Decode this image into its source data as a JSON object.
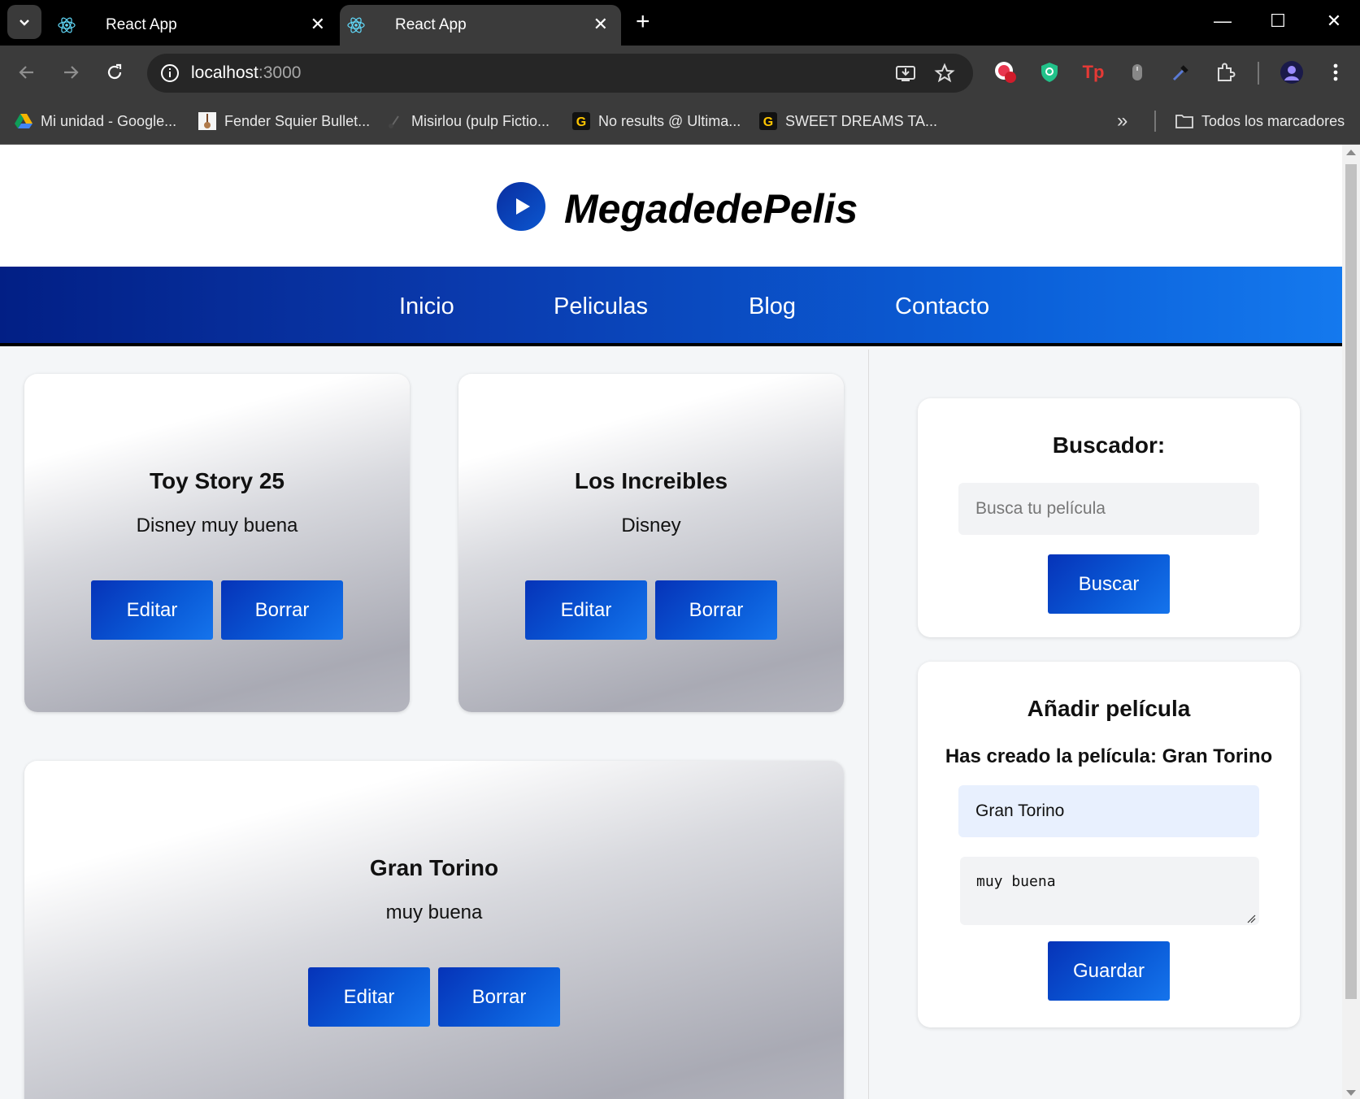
{
  "browser": {
    "tabs": [
      {
        "title": "React App",
        "active": false
      },
      {
        "title": "React App",
        "active": true
      }
    ],
    "address": {
      "host": "localhost",
      "port": ":3000"
    },
    "bookmarks": [
      {
        "label": "Mi unidad - Google...",
        "icon": "google-drive-icon"
      },
      {
        "label": "Fender Squier Bullet...",
        "icon": "guitar-icon"
      },
      {
        "label": "Misirlou (pulp Fictio...",
        "icon": "music-icon"
      },
      {
        "label": "No results @ Ultima...",
        "icon": "ultimate-guitar-icon"
      },
      {
        "label": "SWEET DREAMS TA...",
        "icon": "ultimate-guitar-icon"
      }
    ],
    "all_bookmarks_label": "Todos los marcadores",
    "badge_count": "!"
  },
  "site": {
    "title": "MegadedePelis",
    "nav": [
      "Inicio",
      "Peliculas",
      "Blog",
      "Contacto"
    ]
  },
  "movies": [
    {
      "title": "Toy Story 25",
      "description": "Disney muy buena",
      "edit_label": "Editar",
      "delete_label": "Borrar"
    },
    {
      "title": "Los Increibles",
      "description": "Disney",
      "edit_label": "Editar",
      "delete_label": "Borrar"
    },
    {
      "title": "Gran Torino",
      "description": "muy buena",
      "edit_label": "Editar",
      "delete_label": "Borrar"
    }
  ],
  "search": {
    "title": "Buscador:",
    "placeholder": "Busca tu película",
    "button_label": "Buscar"
  },
  "add_movie": {
    "title": "Añadir película",
    "status": "Has creado la película: Gran Torino",
    "title_value": "Gran Torino",
    "description_value": "muy buena",
    "button_label": "Guardar"
  },
  "colors": {
    "accent_dark": "#021f85",
    "accent_light": "#1479ee"
  }
}
